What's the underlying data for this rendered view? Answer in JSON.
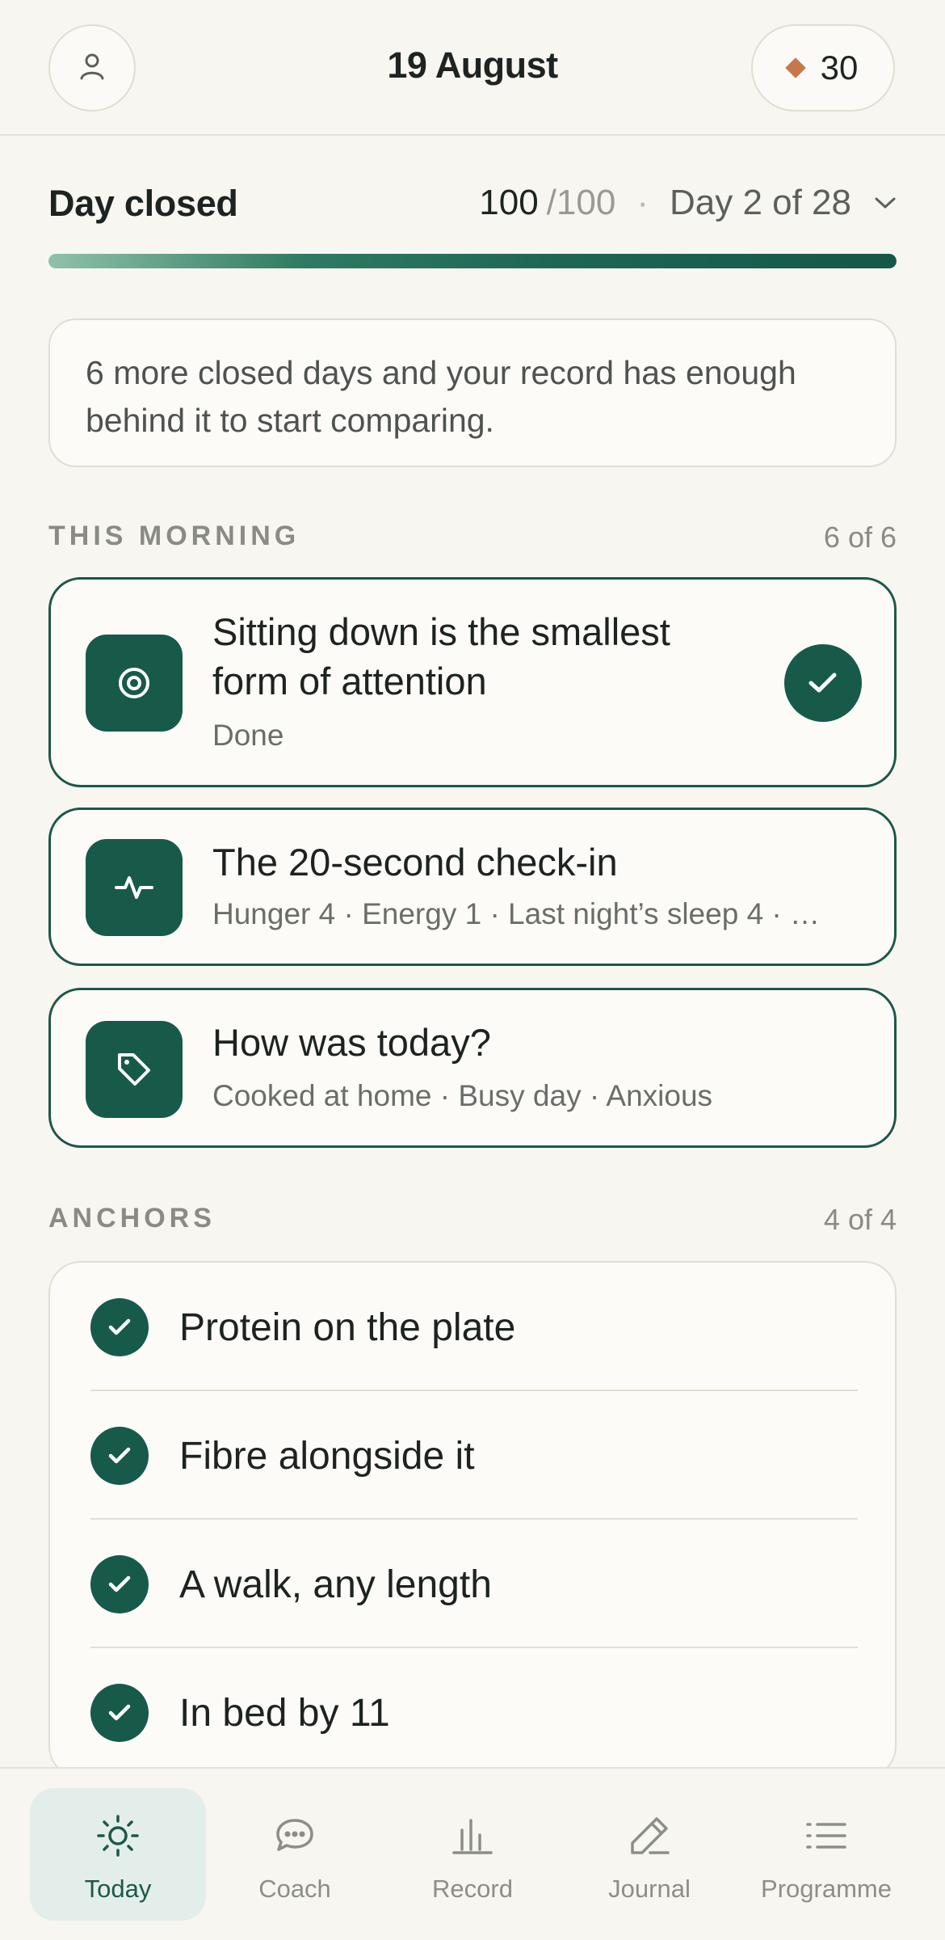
{
  "header": {
    "date": "19 August",
    "streak_count": "30",
    "profile_icon": "person-icon",
    "streak_icon": "diamond-icon",
    "streak_color": "#c7784b"
  },
  "status": {
    "label": "Day closed",
    "score": "100",
    "score_max": "/100",
    "separator": "·",
    "day": "Day 2 of 28",
    "progress_fraction": 1.0
  },
  "info": {
    "text": "6 more closed days and your record has enough behind it to start comparing."
  },
  "morning": {
    "title": "THIS MORNING",
    "count": "6 of 6",
    "cards": [
      {
        "title": "Sitting down is the smallest form of attention",
        "subtitle": "Done",
        "icon": "target-icon",
        "done": true
      },
      {
        "title": "The 20-second check-in",
        "subtitle": "Hunger 4 · Energy 1 · Last night’s sleep 4 · …",
        "icon": "pulse-icon",
        "done": false
      },
      {
        "title": "How was today?",
        "subtitle": "Cooked at home · Busy day · Anxious",
        "icon": "tag-icon",
        "done": false
      }
    ]
  },
  "anchors": {
    "title": "ANCHORS",
    "count": "4 of 4",
    "items": [
      {
        "label": "Protein on the plate"
      },
      {
        "label": "Fibre alongside it"
      },
      {
        "label": "A walk, any length"
      },
      {
        "label": "In bed by 11"
      }
    ]
  },
  "nav": {
    "items": [
      {
        "label": "Today",
        "icon": "sun-icon",
        "active": true
      },
      {
        "label": "Coach",
        "icon": "chat-icon",
        "active": false
      },
      {
        "label": "Record",
        "icon": "bar-chart-icon",
        "active": false
      },
      {
        "label": "Journal",
        "icon": "pen-icon",
        "active": false
      },
      {
        "label": "Programme",
        "icon": "list-icon",
        "active": false
      }
    ]
  },
  "colors": {
    "accent": "#175a4a",
    "background": "#f8f6f1",
    "card": "#fcfbf8"
  }
}
